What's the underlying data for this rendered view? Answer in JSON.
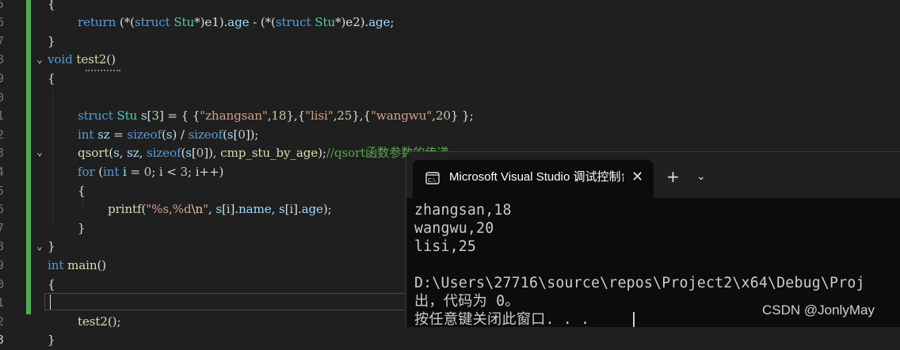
{
  "editor": {
    "gutter": [
      "5",
      "6",
      "7",
      "8",
      "9",
      "0",
      "1",
      "2",
      "3",
      "4",
      "5",
      "6",
      "7",
      "8",
      "9",
      "0",
      "1",
      "2",
      "3"
    ],
    "lines": [
      [
        [
          "pl",
          "{"
        ]
      ],
      [
        [
          "kw",
          "return"
        ],
        [
          "pl",
          " (*("
        ],
        [
          "kw",
          "struct"
        ],
        [
          "pl",
          " "
        ],
        [
          "ty",
          "Stu"
        ],
        [
          "pl",
          "*)e1)."
        ],
        [
          "var",
          "age"
        ],
        [
          "pl",
          " - (*("
        ],
        [
          "kw",
          "struct"
        ],
        [
          "pl",
          " "
        ],
        [
          "ty",
          "Stu"
        ],
        [
          "pl",
          "*)e2)."
        ],
        [
          "var",
          "age"
        ],
        [
          "pl",
          ";"
        ]
      ],
      [
        [
          "pl",
          "}"
        ]
      ],
      [
        [
          "kw",
          "void"
        ],
        [
          "pl",
          " "
        ],
        [
          "fn",
          "test2"
        ],
        [
          "pl",
          "()"
        ]
      ],
      [
        [
          "pl",
          "{"
        ]
      ],
      [
        [
          "pl",
          ""
        ]
      ],
      [
        [
          "kw",
          "struct"
        ],
        [
          "pl",
          " "
        ],
        [
          "ty",
          "Stu"
        ],
        [
          "pl",
          " "
        ],
        [
          "var",
          "s"
        ],
        [
          "pl",
          "["
        ],
        [
          "num",
          "3"
        ],
        [
          "pl",
          "] = { {"
        ],
        [
          "str",
          "\"zhangsan\""
        ],
        [
          "pl",
          ","
        ],
        [
          "num",
          "18"
        ],
        [
          "pl",
          "},{"
        ],
        [
          "str",
          "\"lisi\""
        ],
        [
          "pl",
          ","
        ],
        [
          "num",
          "25"
        ],
        [
          "pl",
          "},{"
        ],
        [
          "str",
          "\"wangwu\""
        ],
        [
          "pl",
          ","
        ],
        [
          "num",
          "20"
        ],
        [
          "pl",
          "} };"
        ]
      ],
      [
        [
          "kw",
          "int"
        ],
        [
          "pl",
          " "
        ],
        [
          "var",
          "sz"
        ],
        [
          "pl",
          " = "
        ],
        [
          "kw",
          "sizeof"
        ],
        [
          "pl",
          "("
        ],
        [
          "var",
          "s"
        ],
        [
          "pl",
          ") / "
        ],
        [
          "kw",
          "sizeof"
        ],
        [
          "pl",
          "("
        ],
        [
          "var",
          "s"
        ],
        [
          "pl",
          "["
        ],
        [
          "num",
          "0"
        ],
        [
          "pl",
          "]);"
        ]
      ],
      [
        [
          "fn",
          "qsort"
        ],
        [
          "pl",
          "("
        ],
        [
          "var",
          "s"
        ],
        [
          "pl",
          ", "
        ],
        [
          "var",
          "sz"
        ],
        [
          "pl",
          ", "
        ],
        [
          "kw",
          "sizeof"
        ],
        [
          "pl",
          "("
        ],
        [
          "var",
          "s"
        ],
        [
          "pl",
          "["
        ],
        [
          "num",
          "0"
        ],
        [
          "pl",
          "]), "
        ],
        [
          "fn",
          "cmp_stu_by_age"
        ],
        [
          "pl",
          ");"
        ],
        [
          "cm",
          "//qsort函数参数的传递"
        ]
      ],
      [
        [
          "kw",
          "for"
        ],
        [
          "pl",
          " ("
        ],
        [
          "kw",
          "int"
        ],
        [
          "pl",
          " "
        ],
        [
          "var",
          "i"
        ],
        [
          "pl",
          " = "
        ],
        [
          "num",
          "0"
        ],
        [
          "pl",
          "; "
        ],
        [
          "var",
          "i"
        ],
        [
          "pl",
          " < "
        ],
        [
          "num",
          "3"
        ],
        [
          "pl",
          "; "
        ],
        [
          "var",
          "i"
        ],
        [
          "pl",
          "++)"
        ]
      ],
      [
        [
          "pl",
          "{"
        ]
      ],
      [
        [
          "fn",
          "printf"
        ],
        [
          "pl",
          "("
        ],
        [
          "str",
          "\"%s,%d"
        ],
        [
          "esc",
          "\\n"
        ],
        [
          "str",
          "\""
        ],
        [
          "pl",
          ", "
        ],
        [
          "var",
          "s"
        ],
        [
          "pl",
          "["
        ],
        [
          "var",
          "i"
        ],
        [
          "pl",
          "]."
        ],
        [
          "var",
          "name"
        ],
        [
          "pl",
          ", "
        ],
        [
          "var",
          "s"
        ],
        [
          "pl",
          "["
        ],
        [
          "var",
          "i"
        ],
        [
          "pl",
          "]."
        ],
        [
          "var",
          "age"
        ],
        [
          "pl",
          ");"
        ]
      ],
      [
        [
          "pl",
          "}"
        ]
      ],
      [
        [
          "pl",
          "}"
        ]
      ],
      [
        [
          "kw",
          "int"
        ],
        [
          "pl",
          " "
        ],
        [
          "fn",
          "main"
        ],
        [
          "pl",
          "()"
        ]
      ],
      [
        [
          "pl",
          "{"
        ]
      ],
      [
        [
          "pl",
          ""
        ]
      ],
      [
        [
          "fn",
          "test2"
        ],
        [
          "pl",
          "();"
        ]
      ],
      [
        [
          "pl",
          "}"
        ]
      ]
    ]
  },
  "terminal": {
    "tab_title": "Microsoft Visual Studio 调试控制台",
    "close_glyph": "✕",
    "new_tab_glyph": "+",
    "dropdown_glyph": "⌄",
    "output": [
      "zhangsan,18",
      "wangwu,20",
      "lisi,25",
      "",
      "D:\\Users\\27716\\source\\repos\\Project2\\x64\\Debug\\Proj",
      "出，代码为 0。",
      "按任意键关闭此窗口. . ."
    ]
  },
  "watermark": "CSDN @JonlyMay",
  "colors": {
    "editor_bg": "#1f1f1f",
    "keyword": "#569cd6",
    "type": "#4ec9b0",
    "function": "#dcdcaa",
    "string": "#d69d85",
    "number": "#b5cea8",
    "comment": "#57a64a",
    "change_bar": "#4cae4f",
    "terminal_bg": "#0c0c0c"
  }
}
